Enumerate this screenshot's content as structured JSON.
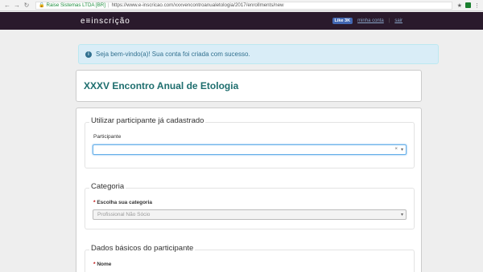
{
  "browser": {
    "secure_label": "Raise Sistemas LTDA [BR]",
    "url": "https://www.e-inscricao.com/xxxvencontroanualetologia/2017/enrollments/new"
  },
  "navbar": {
    "brand": "e≡inscrição",
    "like_label": "Like 3K",
    "account_link": "minha conta",
    "divider": "|",
    "logout_link": "sair"
  },
  "alert": {
    "message": "Seja bem-vindo(a)! Sua conta foi criada com sucesso."
  },
  "event": {
    "title": "XXXV Encontro Anual de Etologia"
  },
  "form": {
    "existing_participant": {
      "legend": "Utilizar participante já cadastrado",
      "label": "Participante",
      "value": ""
    },
    "category": {
      "legend": "Categoria",
      "required_mark": "*",
      "label": "Escolha sua categoria",
      "value": "Profissional Não Sócio"
    },
    "participant_data": {
      "legend": "Dados básicos do participante",
      "required_mark": "*",
      "name_label": "Nome"
    }
  }
}
